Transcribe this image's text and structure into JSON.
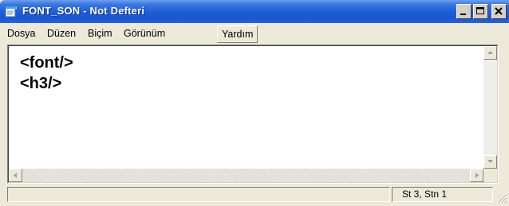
{
  "window": {
    "title": "FONT_SON - Not Defteri",
    "icon": "notepad-icon",
    "controls": [
      "minimize-icon",
      "maximize-icon",
      "close-icon"
    ]
  },
  "menu": {
    "items": [
      {
        "label": "Dosya"
      },
      {
        "label": "Düzen"
      },
      {
        "label": "Biçim"
      },
      {
        "label": "Görünüm"
      },
      {
        "label": "Yardım",
        "state": "hover"
      }
    ]
  },
  "editor": {
    "lines": [
      "<font/>",
      "<h3/>"
    ]
  },
  "statusbar": {
    "position": "St 3, Stn 1"
  },
  "colors": {
    "titlebar": "#1f5fd8",
    "chrome": "#ece9d8",
    "editor_bg": "#ffffff"
  }
}
